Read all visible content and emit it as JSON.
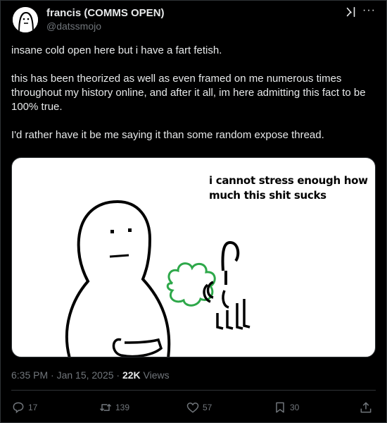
{
  "author": {
    "display_name": "francis (COMMS OPEN)",
    "handle": "@datssmojo"
  },
  "icons": {
    "avatar": "avatar-face",
    "grok": "grok-icon",
    "more": "more-icon",
    "reply": "reply-icon",
    "repost": "repost-icon",
    "like": "like-icon",
    "bookmark": "bookmark-icon",
    "share": "share-icon"
  },
  "tweet": {
    "paragraphs": [
      "insane cold open here but i have a fart fetish.",
      "this has been theorized as well as even framed on me numerous times throughout my history online, and after it all, im here admitting this fact to be 100% true.",
      "I'd rather have it be me saying it than some random expose thread."
    ]
  },
  "media": {
    "caption": "i cannot stress enough how much this shit sucks",
    "colors": {
      "background": "#ffffff",
      "stroke": "#000000",
      "cloud": "#2ea84a"
    }
  },
  "meta": {
    "timestamp": "6:35 PM · Jan 15, 2025 · ",
    "views_count": "22K",
    "views_label": " Views"
  },
  "actions": {
    "replies": "17",
    "reposts": "139",
    "likes": "57",
    "bookmarks": "30"
  },
  "colors": {
    "background": "#000000",
    "text": "#e7e9ea",
    "muted": "#71767b",
    "border": "#2f3336"
  }
}
